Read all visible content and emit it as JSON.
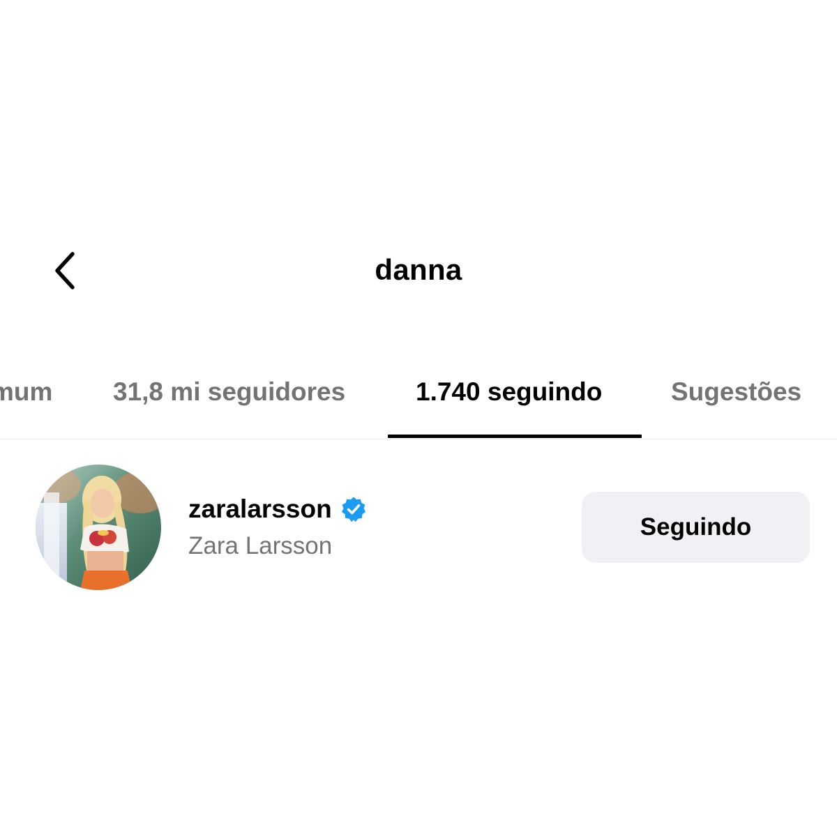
{
  "header": {
    "title": "danna",
    "back_icon": "chevron-left-icon"
  },
  "tabs": [
    {
      "label": "mum",
      "active": false
    },
    {
      "label": "31,8 mi seguidores",
      "active": false
    },
    {
      "label": "1.740 seguindo",
      "active": true
    },
    {
      "label": "Sugestões",
      "active": false
    }
  ],
  "list": [
    {
      "username": "zaralarsson",
      "full_name": "Zara Larsson",
      "verified": true,
      "verified_icon": "verified-badge-icon",
      "button_label": "Seguindo"
    }
  ],
  "colors": {
    "text_primary": "#000000",
    "text_secondary": "#737373",
    "verified_blue": "#1a9cf5",
    "button_background": "#eff1f4"
  }
}
